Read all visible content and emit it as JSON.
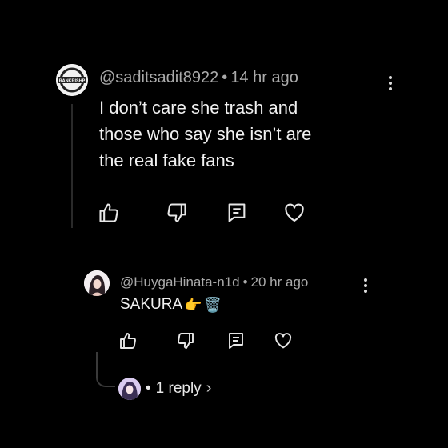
{
  "comment": {
    "avatar_text": "RANKRISHP",
    "username": "@saditsadit8922",
    "separator": "•",
    "time": "14 hr ago",
    "text_lines": [
      "I don’t care she trash and",
      "those who say she isn’t are",
      "the real fake fans"
    ]
  },
  "reply": {
    "username": "@HuygaHinata-n1d",
    "separator": "•",
    "time": "20 hr ago",
    "text": "SAKURA",
    "emojis": [
      "👉",
      "🗑️"
    ]
  },
  "replies_link": {
    "separator": "•",
    "label": "1 reply",
    "chevron": "›"
  },
  "icons": [
    "like-icon",
    "dislike-icon",
    "reply-icon",
    "heart-icon",
    "more-icon",
    "chevron-right-icon"
  ]
}
